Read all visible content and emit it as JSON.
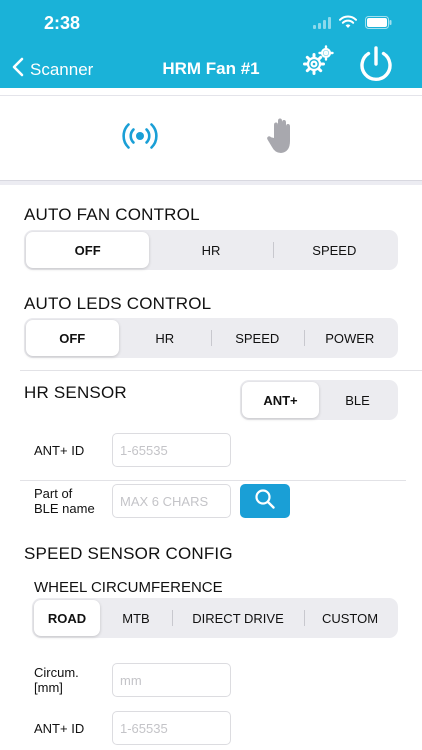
{
  "status_bar": {
    "time": "2:38"
  },
  "nav": {
    "back_label": "Scanner",
    "title": "HRM Fan #1"
  },
  "auto_fan": {
    "title": "AUTO FAN CONTROL",
    "options": [
      "OFF",
      "HR",
      "SPEED"
    ],
    "selected": "OFF"
  },
  "auto_leds": {
    "title": "AUTO LEDS CONTROL",
    "options": [
      "OFF",
      "HR",
      "SPEED",
      "POWER"
    ],
    "selected": "OFF"
  },
  "hr_sensor": {
    "title": "HR SENSOR",
    "options": [
      "ANT+",
      "BLE"
    ],
    "selected": "ANT+",
    "ant_id_label": "ANT+ ID",
    "ant_id_placeholder": "1-65535",
    "ble_name_label_line1": "Part of",
    "ble_name_label_line2": "BLE name",
    "ble_name_placeholder": "MAX 6 CHARS"
  },
  "speed_sensor": {
    "title": "SPEED SENSOR CONFIG",
    "wheel_title": "WHEEL CIRCUMFERENCE",
    "wheel_options": [
      "ROAD",
      "MTB",
      "DIRECT DRIVE",
      "CUSTOM"
    ],
    "selected": "ROAD",
    "circum_label_line1": "Circum.",
    "circum_label_line2": "[mm]",
    "circum_placeholder": "mm",
    "ant_id_label": "ANT+ ID",
    "ant_id_placeholder": "1-65535"
  },
  "icons": {
    "gear": "gear-icon",
    "power": "power-icon",
    "broadcast": "broadcast-icon",
    "hand": "hand-icon",
    "search": "search-icon"
  },
  "colors": {
    "header": "#1ab2d8",
    "accent": "#1a9fd6",
    "hand_gray": "#a8a8ae"
  }
}
